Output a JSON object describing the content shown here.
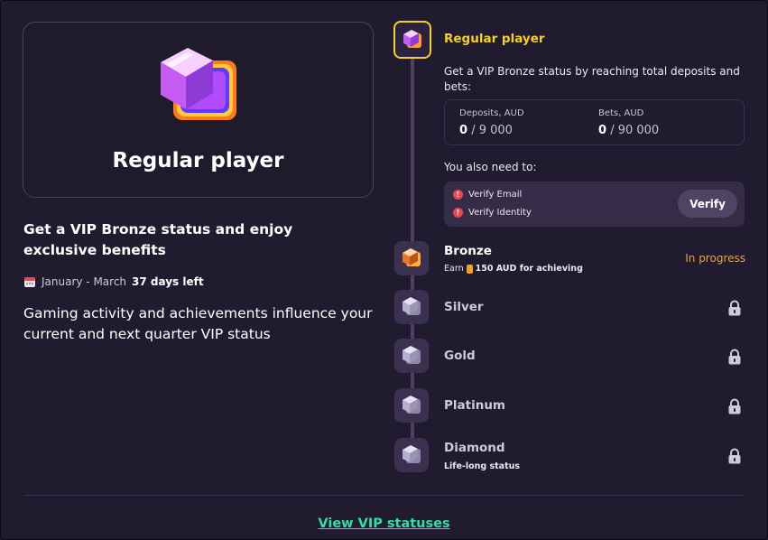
{
  "hero": {
    "gem_icon": "purple-gem-icon",
    "title": "Regular player"
  },
  "info": {
    "heading": "Get a VIP Bronze status and enjoy exclusive benefits",
    "period": "January - March",
    "days_left": "37 days left",
    "description": "Gaming activity and achievements influence your current and next quarter VIP status"
  },
  "current_level": {
    "title": "Regular player",
    "requirement": "Get a VIP Bronze status by reaching total deposits and bets:",
    "deposits": {
      "label": "Deposits, AUD",
      "current": "0",
      "target": "/ 9 000"
    },
    "bets": {
      "label": "Bets, AUD",
      "current": "0",
      "target": "/ 90 000"
    },
    "also_need": "You also need to:",
    "tasks": [
      "Verify Email",
      "Verify Identity"
    ],
    "verify_label": "Verify"
  },
  "levels": [
    {
      "name": "Bronze",
      "sub_prefix": "Earn",
      "sub_amount": "150 AUD for achieving",
      "status": "In progress"
    },
    {
      "name": "Silver"
    },
    {
      "name": "Gold"
    },
    {
      "name": "Platinum"
    },
    {
      "name": "Diamond",
      "sub": "Life-long status"
    }
  ],
  "footer": {
    "link": "View VIP statuses"
  },
  "colors": {
    "background": "#211b2f",
    "accent_yellow": "#f3d21a",
    "accent_orange": "#f4a321",
    "link_green": "#2fe0a5"
  }
}
